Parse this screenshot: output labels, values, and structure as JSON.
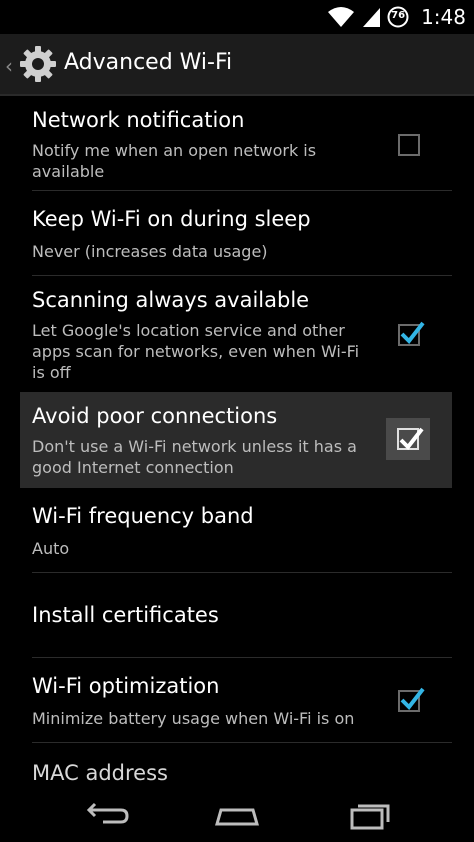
{
  "status_bar": {
    "time": "1:48",
    "battery_level": "76",
    "icons": [
      "wifi-icon",
      "signal-icon",
      "battery-icon"
    ]
  },
  "action_bar": {
    "title": "Advanced Wi-Fi",
    "icon": "settings-gear-icon"
  },
  "settings": [
    {
      "title": "Network notification",
      "summary": "Notify me when an open network is available",
      "checkbox": true,
      "checked": false
    },
    {
      "title": "Keep Wi-Fi on during sleep",
      "summary": "Never (increases data usage)",
      "checkbox": false
    },
    {
      "title": "Scanning always available",
      "summary": "Let Google's location service and other apps scan for networks, even when Wi-Fi is off",
      "checkbox": true,
      "checked": true
    },
    {
      "title": "Avoid poor connections",
      "summary": "Don't use a Wi-Fi network unless it has a good Internet connection",
      "checkbox": true,
      "checked": true,
      "pressed": true
    },
    {
      "title": "Wi-Fi frequency band",
      "summary": "Auto",
      "checkbox": false
    },
    {
      "title": "Install certificates",
      "summary": "",
      "checkbox": false
    },
    {
      "title": "Wi-Fi optimization",
      "summary": "Minimize battery usage when Wi-Fi is on",
      "checkbox": true,
      "checked": true
    },
    {
      "title": "MAC address",
      "summary": "",
      "checkbox": false
    }
  ],
  "nav_bar": {
    "icons": [
      "back-icon",
      "home-icon",
      "recents-icon"
    ]
  },
  "colors": {
    "accent_check": "#33b5e5",
    "pressed_row": "#2b2b2b",
    "action_bar": "#1c1c1c"
  }
}
